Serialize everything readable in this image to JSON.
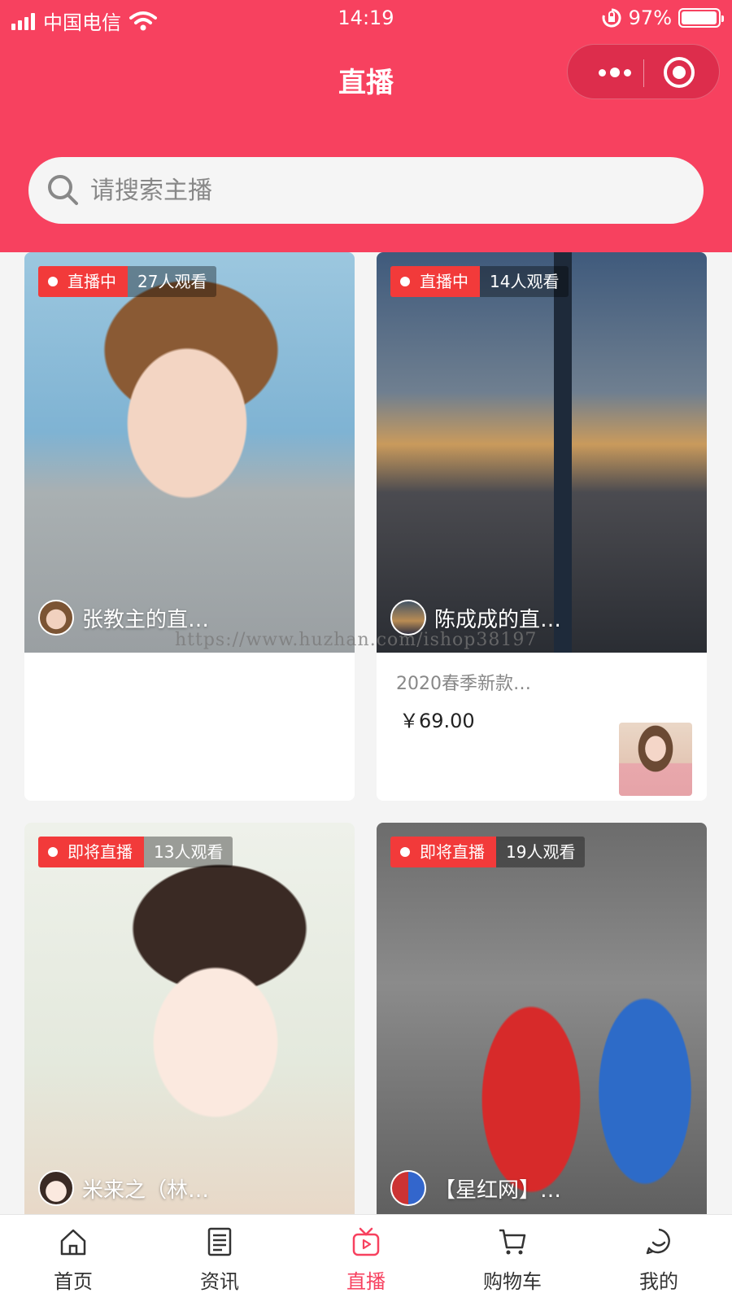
{
  "status_bar": {
    "carrier": "中国电信",
    "time": "14:19",
    "battery": "97%",
    "battery_level": 0.97
  },
  "nav": {
    "title": "直播"
  },
  "search": {
    "placeholder": "请搜索主播"
  },
  "cards": [
    {
      "status": "直播中",
      "viewers": "27人观看",
      "anchor": "张教主的直…"
    },
    {
      "status": "直播中",
      "viewers": "14人观看",
      "anchor": "陈成成的直…",
      "product": {
        "name": "2020春季新款…",
        "price": "￥69.00"
      }
    },
    {
      "status": "即将直播",
      "viewers": "13人观看",
      "anchor": "米来之（林…"
    },
    {
      "status": "即将直播",
      "viewers": "19人观看",
      "anchor": "【星红网】…"
    }
  ],
  "watermark": "https://www.huzhan.com/ishop38197",
  "tabbar": {
    "items": [
      {
        "label": "首页",
        "icon": "home-icon"
      },
      {
        "label": "资讯",
        "icon": "news-icon"
      },
      {
        "label": "直播",
        "icon": "live-icon",
        "active": true
      },
      {
        "label": "购物车",
        "icon": "cart-icon"
      },
      {
        "label": "我的",
        "icon": "profile-icon"
      }
    ],
    "active_color": "#f7415f"
  },
  "colors": {
    "brand": "#f7415f",
    "live_tag": "#f23a3a"
  }
}
